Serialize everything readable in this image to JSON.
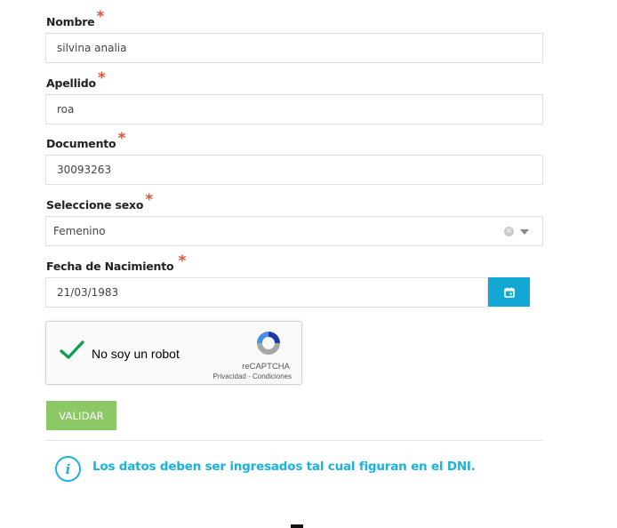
{
  "form": {
    "nombre": {
      "label": "Nombre",
      "required_mark": "*",
      "value": "silvina analia"
    },
    "apellido": {
      "label": "Apellido",
      "required_mark": "*",
      "value": "roa"
    },
    "documento": {
      "label": "Documento",
      "required_mark": "*",
      "value": "30093263"
    },
    "sexo": {
      "label": "Seleccione sexo",
      "required_mark": "*",
      "selected": "Femenino"
    },
    "fecha": {
      "label": "Fecha de Nacimiento",
      "required_mark": "*",
      "value": "21/03/1983"
    }
  },
  "captcha": {
    "label": "No soy un robot",
    "checked": true,
    "brand": "reCAPTCHA",
    "links": "Privacidad - Condiciones"
  },
  "actions": {
    "validar_label": "VALIDAR"
  },
  "notice": {
    "text": "Los datos deben ser ingresados tal cual figuran en el DNI."
  },
  "icons": {
    "clear": "clear-icon",
    "dropdown": "chevron-down-icon",
    "calendar": "calendar-icon",
    "checkmark": "checkmark-icon",
    "recaptcha": "recaptcha-logo-icon",
    "info": "info-icon"
  },
  "colors": {
    "required": "#e2533b",
    "accent_blue": "#13a8d4",
    "button_green": "#8cc866",
    "check_green": "#0f9d58",
    "info_blue": "#1ab3dc"
  }
}
